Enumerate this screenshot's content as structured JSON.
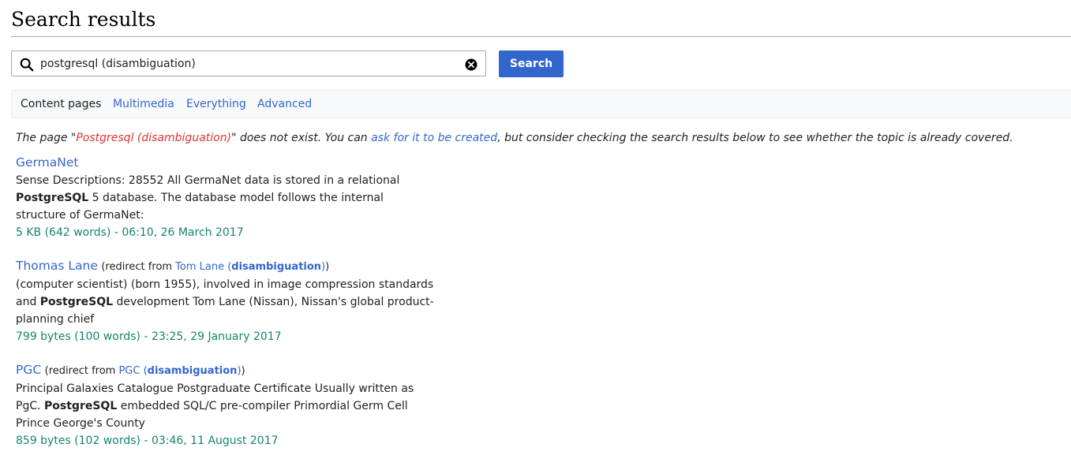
{
  "page": {
    "title": "Search results"
  },
  "search": {
    "query": "postgresql (disambiguation)",
    "button_label": "Search"
  },
  "profiles": {
    "content_pages": "Content pages",
    "multimedia": "Multimedia",
    "everything": "Everything",
    "advanced": "Advanced"
  },
  "notice": {
    "prefix": "The page \"",
    "page_name": "Postgresql (disambiguation)",
    "middle": "\" does not exist. You can ",
    "create_link": "ask for it to be created",
    "suffix": ", but consider checking the search results below to see whether the topic is already covered."
  },
  "results": [
    {
      "title": "GermaNet",
      "snippet": [
        "Sense Descriptions: 28552 All GermaNet data is stored in a relational",
        {
          "bold": "PostgreSQL",
          "rest": " 5 database. The database model follows the internal"
        },
        "structure of GermaNet:"
      ],
      "meta": "5 KB (642 words) - 06:10, 26 March 2017"
    },
    {
      "title": "Thomas Lane",
      "redirect_from": "(redirect from ",
      "redirect_page": "Tom Lane (",
      "redirect_bold": "disambiguation",
      "redirect_close": ")",
      "redirect_end": ")",
      "snippet": [
        "(computer scientist) (born 1955), involved in image compression standards",
        {
          "pre": "and ",
          "bold": "PostgreSQL",
          "rest": " development Tom Lane (Nissan), Nissan's global product-"
        },
        "planning chief"
      ],
      "meta": "799 bytes (100 words) - 23:25, 29 January 2017"
    },
    {
      "title": "PGC",
      "redirect_from": "(redirect from ",
      "redirect_page": "PGC (",
      "redirect_bold": "disambiguation",
      "redirect_close": ")",
      "redirect_end": ")",
      "snippet": [
        "Principal Galaxies Catalogue Postgraduate Certificate Usually written as",
        {
          "pre": "PgC. ",
          "bold": "PostgreSQL",
          "rest": " embedded SQL/C pre-compiler Primordial Germ Cell"
        },
        "Prince George's County"
      ],
      "meta": "859 bytes (102 words) - 03:46, 11 August 2017"
    }
  ],
  "icons": {
    "search": "magnifier-icon",
    "clear": "clear-circle-x-icon"
  },
  "colors": {
    "link": "#3366cc",
    "new_link": "#dd3333",
    "meta": "#14866d",
    "button": "#3366cc"
  }
}
